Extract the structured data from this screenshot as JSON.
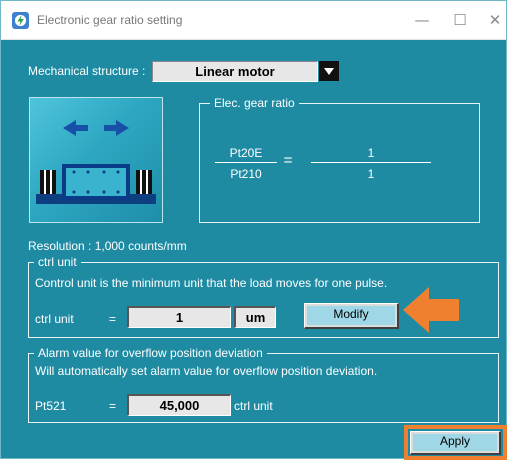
{
  "window": {
    "title": "Electronic gear ratio setting",
    "controls": {
      "minimize": "—",
      "maximize": "☐",
      "close": "✕"
    }
  },
  "mechanical": {
    "label": "Mechanical structure :",
    "selected": "Linear motor"
  },
  "gear_ratio": {
    "legend": "Elec. gear ratio",
    "numerator_param": "Pt20E",
    "denominator_param": "Pt210",
    "equals": "=",
    "numerator_value": "1",
    "denominator_value": "1"
  },
  "resolution": "Resolution : 1,000 counts/mm",
  "ctrl_unit": {
    "legend": "ctrl unit",
    "description": "Control unit is the minimum unit that the load moves for one pulse.",
    "label": "ctrl unit",
    "equals": "=",
    "value": "1",
    "unit": "um",
    "modify_label": "Modify"
  },
  "alarm": {
    "legend": "Alarm value for overflow position deviation",
    "description": "Will automatically set alarm value for overflow position deviation.",
    "param": "Pt521",
    "equals": "=",
    "value": "45,000",
    "unit": "ctrl unit"
  },
  "apply_label": "Apply",
  "colors": {
    "background": "#1f8ba3",
    "highlight": "#ee8030",
    "button_face": "#9fd7e6"
  },
  "icons": {
    "app": "gear-ratio-app-icon",
    "dropdown": "dropdown-arrow-icon",
    "motor": "linear-motor-illustration",
    "callout": "orange-arrow-callout"
  }
}
